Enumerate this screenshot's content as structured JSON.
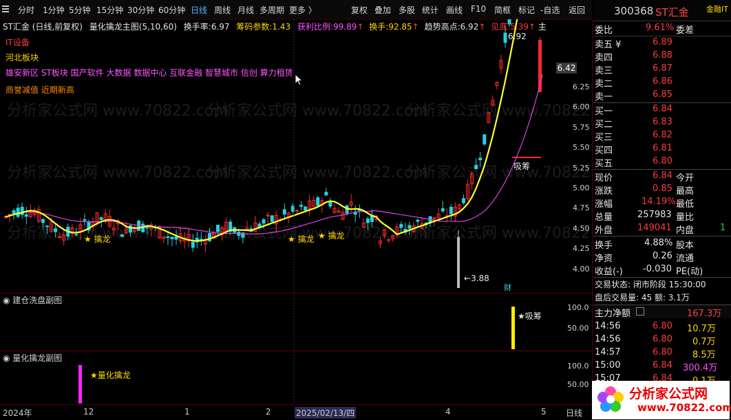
{
  "toolbar": {
    "left_items": [
      "分时",
      "1分钟",
      "5分钟",
      "15分钟",
      "30分钟",
      "60分钟",
      "日线",
      "周线",
      "月线",
      "多周期",
      "更多 〉"
    ],
    "right_items": [
      "复权",
      "叠加",
      "多股",
      "统计",
      "画线",
      "F10",
      "简框",
      "标记",
      "-自选",
      "返回"
    ]
  },
  "stock": {
    "code": "300368",
    "name": "ST汇金",
    "tag": "金融IT"
  },
  "info_line": {
    "title": "ST汇金 (日线,前复权)",
    "indicator": "量化擒龙主图(5,10,60)",
    "turnover_label": "换手率:",
    "turnover_val": "6.97",
    "chip_label": "筹码参数:",
    "chip_val": "1.43",
    "profit_label": "获利比例:",
    "profit_val": "99.89",
    "hand_label": "换手:",
    "hand_val": "92.85",
    "trend_label": "趋势高点:",
    "trend_val": "6.92",
    "top_label": "见底:",
    "top_val": "5.39",
    "main_label": "主"
  },
  "tags": {
    "line1": "IT设备",
    "line2": "河北板块",
    "line3": [
      "雄安新区",
      "ST板块",
      "国产软件",
      "大数据",
      "数据中心",
      "互联金融",
      "智慧城市",
      "信创",
      "算力租赁"
    ],
    "line4": [
      "商誉减值",
      "近期新高"
    ]
  },
  "price_labels": {
    "high": "6.92",
    "low": "3.88",
    "current": "6.42",
    "absorb": "吸筹",
    "fin": "财"
  },
  "markers": [
    "★ 擒龙",
    "★ 擒龙",
    "★ 擒龙"
  ],
  "yaxis": [
    "6.25",
    "6.00",
    "5.75",
    "5.50",
    "5.25",
    "5.00",
    "4.75",
    "4.50",
    "4.25",
    "4.00"
  ],
  "sub1": {
    "title": "建仓洗盘副图",
    "label": "★吸筹",
    "y": [
      "100.0",
      "50.00"
    ]
  },
  "sub2": {
    "title": "量化擒龙副图",
    "label": "★量化擒龙",
    "y": [
      "100.0",
      "50.00"
    ]
  },
  "xaxis": {
    "labels": [
      "2024年",
      "12",
      "1",
      "2",
      "2025/02/13/四",
      "4",
      "5"
    ],
    "right": "日线"
  },
  "orderbook": {
    "ratio_label": "委比",
    "ratio_val": "9.61%",
    "diff_label": "委差",
    "asks": [
      {
        "label": "卖五 ¥",
        "price": "6.89"
      },
      {
        "label": "卖四",
        "price": "6.88"
      },
      {
        "label": "卖三",
        "price": "6.87"
      },
      {
        "label": "卖二",
        "price": "6.86"
      },
      {
        "label": "卖一",
        "price": "6.85"
      }
    ],
    "bids": [
      {
        "label": "买一",
        "price": "6.84"
      },
      {
        "label": "买二",
        "price": "6.83"
      },
      {
        "label": "买三",
        "price": "6.82"
      },
      {
        "label": "买四",
        "price": "6.81"
      },
      {
        "label": "买五",
        "price": "6.80"
      }
    ]
  },
  "quote": [
    {
      "l1": "现价",
      "v1": "6.84",
      "l2": "今开",
      "c": "red"
    },
    {
      "l1": "涨跌",
      "v1": "0.85",
      "l2": "最高",
      "c": "red"
    },
    {
      "l1": "涨幅",
      "v1": "14.19%",
      "l2": "最低",
      "c": "red"
    },
    {
      "l1": "总量",
      "v1": "257983",
      "l2": "量比",
      "c": "white"
    },
    {
      "l1": "外盘",
      "v1": "149041",
      "l2": "内盘",
      "c": "red"
    }
  ],
  "quote2": [
    {
      "l1": "换手",
      "v1": "4.88%",
      "l2": "股本"
    },
    {
      "l1": "净资",
      "v1": "0.26",
      "l2": "流通"
    },
    {
      "l1": "收益(-)",
      "v1": "-0.030",
      "l2": "PE(动)"
    }
  ],
  "status": {
    "state": "交易状态: 闭市阶段 15:30:00",
    "after": "盘后交易量: 45  额: 3.1万"
  },
  "flow": {
    "label": "主力净额",
    "value": "167.3万"
  },
  "ticks": [
    {
      "t": "14:56",
      "p": "6.80",
      "v": "10.7万",
      "vc": "yellow"
    },
    {
      "t": "14:56",
      "p": "6.80",
      "v": "0.7万",
      "vc": "yellow"
    },
    {
      "t": "14:57",
      "p": "6.80",
      "v": "8.5万",
      "vc": "yellow"
    },
    {
      "t": "15:00",
      "p": "6.84",
      "v": "300.4万",
      "vc": "magenta"
    },
    {
      "t": "15:07",
      "p": "6.84",
      "v": "0.1万",
      "vc": "yellow"
    }
  ],
  "logo": {
    "main": "分析家公式网",
    "url": "www.70822.com"
  },
  "watermark": "分析家公式网 www.70822.com",
  "colors": {
    "up": "#ff2a2a",
    "down": "#22d3e0",
    "ma_short": "#ffff33",
    "ma_long": "#dd44dd",
    "grid": "#5a0000"
  }
}
